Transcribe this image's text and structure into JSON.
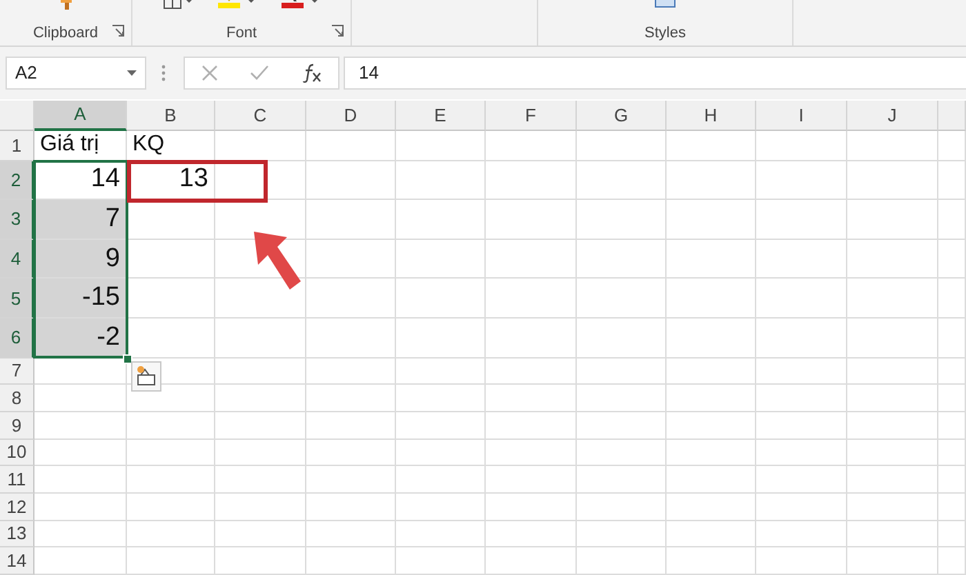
{
  "ribbon": {
    "groups": [
      {
        "label": "Clipboard",
        "launcher": true
      },
      {
        "label": "Font",
        "launcher": true
      },
      {
        "launcher": false
      },
      {
        "label": "Styles",
        "launcher": false
      }
    ]
  },
  "formula_bar": {
    "name_box": "A2",
    "formula": "14"
  },
  "columns": [
    {
      "label": "A",
      "selected": true
    },
    {
      "label": "B",
      "selected": false
    },
    {
      "label": "C",
      "selected": false
    },
    {
      "label": "D",
      "selected": false
    },
    {
      "label": "E",
      "selected": false
    },
    {
      "label": "F",
      "selected": false
    },
    {
      "label": "G",
      "selected": false
    },
    {
      "label": "H",
      "selected": false
    },
    {
      "label": "I",
      "selected": false
    },
    {
      "label": "J",
      "selected": false
    }
  ],
  "rows": [
    {
      "number": "1",
      "selected": false,
      "cells": [
        {
          "text": "Giá trị",
          "kind": "text",
          "selected": false
        },
        {
          "text": "KQ",
          "kind": "text",
          "selected": false
        }
      ]
    },
    {
      "number": "2",
      "selected": true,
      "cells": [
        {
          "text": "14",
          "kind": "number",
          "selected": true,
          "active": true
        },
        {
          "text": "13",
          "kind": "number",
          "selected": false
        }
      ]
    },
    {
      "number": "3",
      "selected": true,
      "cells": [
        {
          "text": "7",
          "kind": "number",
          "selected": true,
          "active": false
        }
      ]
    },
    {
      "number": "4",
      "selected": true,
      "cells": [
        {
          "text": "9",
          "kind": "number",
          "selected": true,
          "active": false
        }
      ]
    },
    {
      "number": "5",
      "selected": true,
      "cells": [
        {
          "text": "-15",
          "kind": "number",
          "selected": true,
          "active": false
        }
      ]
    },
    {
      "number": "6",
      "selected": true,
      "cells": [
        {
          "text": "-2",
          "kind": "number",
          "selected": true,
          "active": false
        }
      ]
    },
    {
      "number": "7",
      "selected": false,
      "cells": []
    },
    {
      "number": "8",
      "selected": false,
      "cells": []
    },
    {
      "number": "9",
      "selected": false,
      "cells": []
    },
    {
      "number": "10",
      "selected": false,
      "cells": []
    },
    {
      "number": "11",
      "selected": false,
      "cells": []
    },
    {
      "number": "12",
      "selected": false,
      "cells": []
    },
    {
      "number": "13",
      "selected": false,
      "cells": []
    },
    {
      "number": "14",
      "selected": false,
      "cells": []
    }
  ]
}
